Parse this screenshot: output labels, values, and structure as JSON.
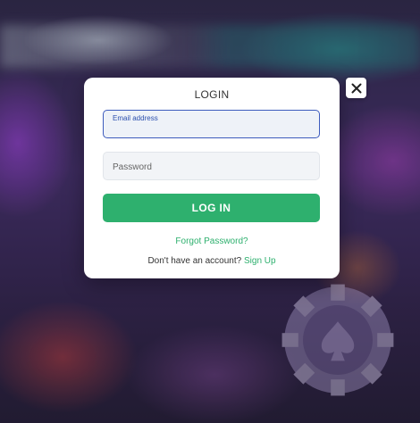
{
  "modal": {
    "title": "LOGIN",
    "email": {
      "label": "Email address",
      "value": ""
    },
    "password": {
      "placeholder": "Password",
      "value": ""
    },
    "login_button": "LOG IN",
    "forgot_password": "Forgot Password?",
    "no_account_text": "Don't have an account?",
    "signup_link": "Sign Up"
  },
  "icons": {
    "close": "close-icon",
    "chip": "poker-chip-spade-icon"
  },
  "colors": {
    "accent": "#2eb06e",
    "focus_border": "#3d5bbd",
    "modal_bg": "#ffffff"
  }
}
